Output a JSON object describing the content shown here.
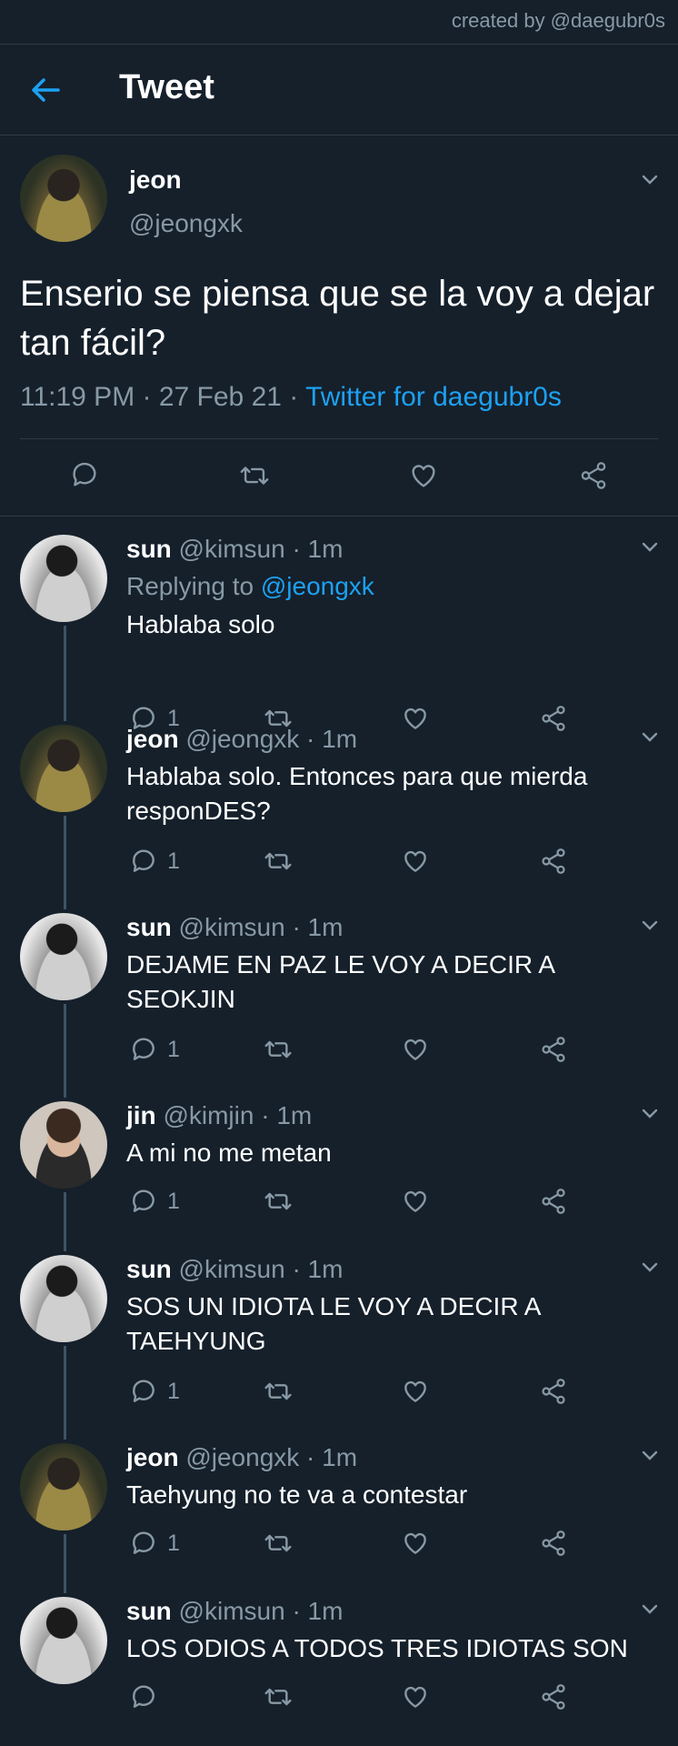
{
  "credit": "created by @daegubr0s",
  "header": {
    "title": "Tweet"
  },
  "main_tweet": {
    "name": "jeon",
    "handle": "@jeongxk",
    "text": "Enserio se piensa que se la voy a dejar tan fácil?",
    "time": "11:19 PM · 27 Feb 21 · ",
    "source": "Twitter for daegubr0s"
  },
  "replies": [
    {
      "name": "sun",
      "meta": "@kimsun · 1m",
      "replying_prefix": "Replying to ",
      "replying_to": "@jeongxk",
      "text": "Hablaba solo",
      "reply_count": "1",
      "avatar": "sun"
    },
    {
      "name": "jeon",
      "meta": "@jeongxk · 1m",
      "text": "Hablaba solo. Entonces para que mierda responDES?",
      "reply_count": "1",
      "avatar": "jeon"
    },
    {
      "name": "sun",
      "meta": "@kimsun · 1m",
      "text": "DEJAME EN PAZ LE VOY A DECIR A SEOKJIN",
      "reply_count": "1",
      "avatar": "sun"
    },
    {
      "name": "jin",
      "meta": "@kimjin · 1m",
      "text": "A mi no me metan",
      "reply_count": "1",
      "avatar": "jin"
    },
    {
      "name": "sun",
      "meta": "@kimsun · 1m",
      "text": "SOS UN IDIOTA LE VOY A DECIR A TAEHYUNG",
      "reply_count": "1",
      "avatar": "sun"
    },
    {
      "name": "jeon",
      "meta": "@jeongxk · 1m",
      "text": "Taehyung no te va a contestar",
      "reply_count": "1",
      "avatar": "jeon"
    },
    {
      "name": "sun",
      "meta": "@kimsun · 1m",
      "text": "LOS ODIOS A TODOS TRES IDIOTAS SON",
      "reply_count": "",
      "avatar": "sun"
    }
  ],
  "colors": {
    "background": "#15202b",
    "accent": "#1da1f2",
    "secondary_text": "#8899a6",
    "divider": "#2f3b47"
  },
  "icons": {
    "back": "arrow-left-icon",
    "more": "chevron-down-icon",
    "reply": "comment-icon",
    "retweet": "retweet-icon",
    "like": "heart-icon",
    "share": "share-icon"
  }
}
